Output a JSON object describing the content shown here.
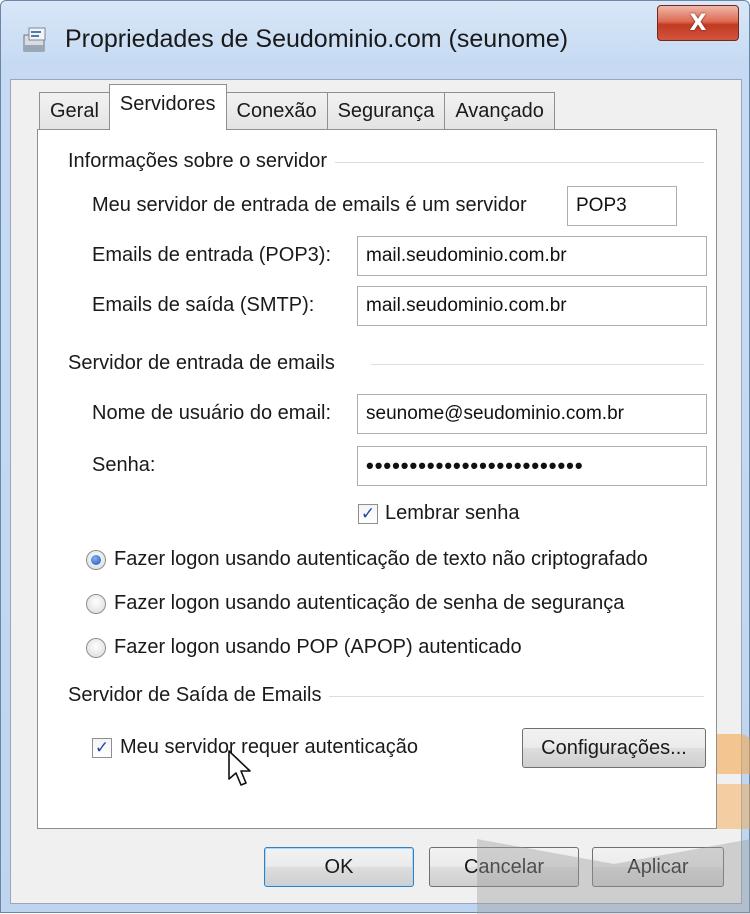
{
  "window": {
    "title": "Propriedades de Seudominio.com (seunome)",
    "close_label": "X"
  },
  "tabs": [
    {
      "label": "Geral"
    },
    {
      "label": "Servidores",
      "active": true
    },
    {
      "label": "Conexão"
    },
    {
      "label": "Segurança"
    },
    {
      "label": "Avançado"
    }
  ],
  "server_info": {
    "group_title": "Informações sobre o servidor",
    "incoming_type_label": "Meu servidor de entrada de emails é um servidor",
    "incoming_type_value": "POP3",
    "incoming_label": "Emails de entrada (POP3):",
    "incoming_value": "mail.seudominio.com.br",
    "outgoing_label": "Emails de saída (SMTP):",
    "outgoing_value": "mail.seudominio.com.br"
  },
  "incoming_server": {
    "group_title": "Servidor de entrada de emails",
    "username_label": "Nome de usuário do email:",
    "username_value": "seunome@seudominio.com.br",
    "password_label": "Senha:",
    "password_value": "•••••••••••••••••••••••••",
    "remember_label": "Lembrar senha",
    "remember_checked": true,
    "auth_options": [
      {
        "label": "Fazer logon usando autenticação de texto não criptografado",
        "selected": true
      },
      {
        "label": "Fazer logon usando autenticação de senha de segurança",
        "selected": false
      },
      {
        "label": "Fazer logon usando POP (APOP) autenticado",
        "selected": false
      }
    ]
  },
  "outgoing_server": {
    "group_title": "Servidor de Saída de Emails",
    "auth_required_label": "Meu servidor requer autenticação",
    "auth_required_checked": true,
    "settings_button": "Configurações..."
  },
  "footer": {
    "ok": "OK",
    "cancel": "Cancelar",
    "apply": "Aplicar"
  },
  "icons": {
    "check": "✓"
  },
  "colors": {
    "watermark_orange": "#f5a443",
    "close_red": "#c23a22"
  }
}
